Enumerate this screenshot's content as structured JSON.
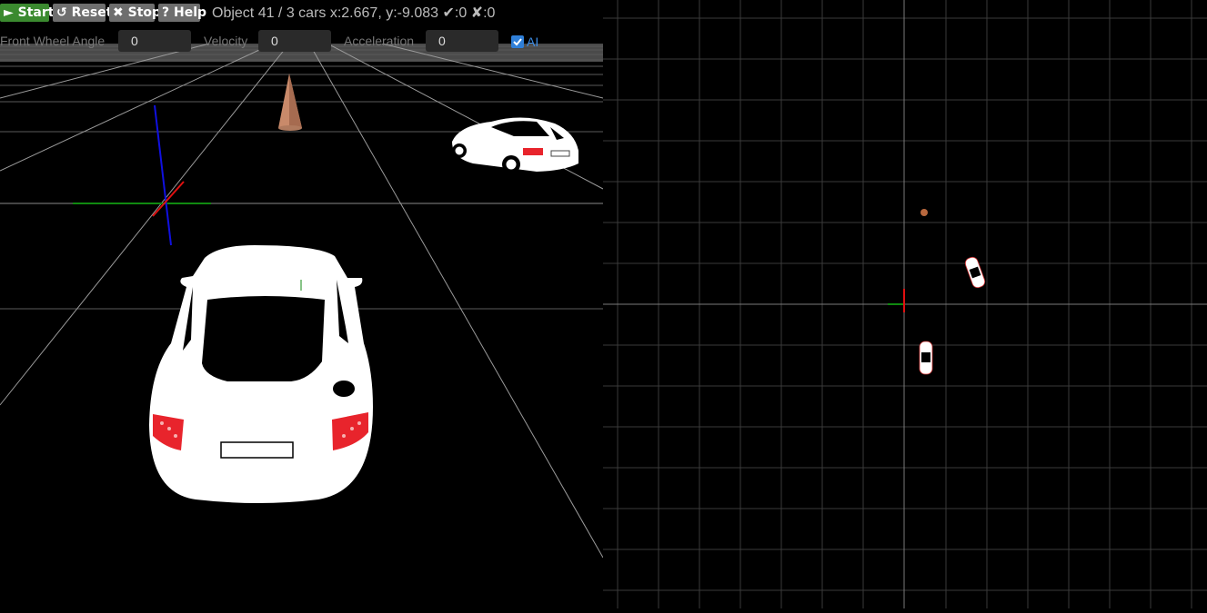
{
  "toolbar": {
    "start_label": "► Start",
    "reset_label": "↺ Reset",
    "stop_label": "✖ Stop",
    "help_label": "? Help",
    "status": "Object 41 / 3 cars x:2.667, y:-9.083 ✔:0 ✘:0"
  },
  "controls": {
    "front_wheel_angle_label": "Front Wheel Angle",
    "front_wheel_angle_value": "0",
    "velocity_label": "Velocity",
    "velocity_value": "0",
    "acceleration_label": "Acceleration",
    "acceleration_value": "0",
    "ai_label": "AI",
    "ai_checked": true
  },
  "icons": {
    "start": "play-icon",
    "reset": "reset-icon",
    "stop": "stop-icon",
    "help": "help-icon",
    "checkbox": "checkmark-icon"
  },
  "colors": {
    "start_button": "#3b8a2f",
    "secondary_button": "#6e6e6e",
    "checkbox": "#2f7fd8",
    "car_body": "#ffffff",
    "tail_light": "#e8242c",
    "cone": "#c98a6a",
    "axis_x": "#e01010",
    "axis_y": "#108a10",
    "axis_z": "#1010e0"
  }
}
